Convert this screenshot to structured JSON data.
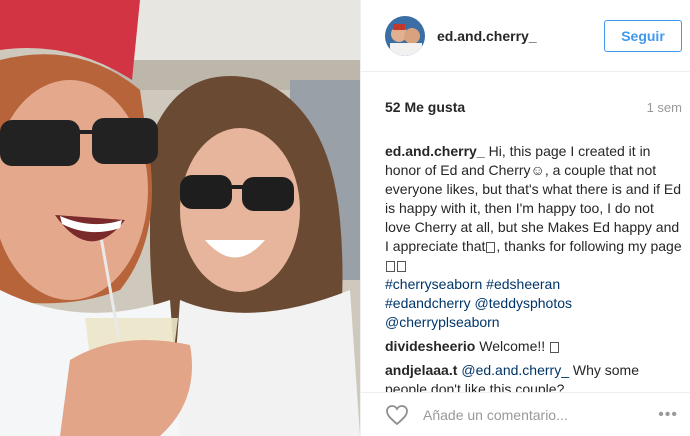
{
  "post": {
    "username": "ed.and.cherry_",
    "follow_label": "Seguir",
    "likes": "52 Me gusta",
    "age": "1 sem"
  },
  "comments": [
    {
      "user": "ed.and.cherry_",
      "text": "Hi, this page I created it in honor of Ed and Cherry☺, a couple that not everyone likes, but that's what there is and if Ed is happy with it, then I'm happy too, I do not love Cherry at all, but she Makes Ed happy and I appreciate that",
      "text2": ", thanks for following my page",
      "tags": [
        "#cherryseaborn",
        "#edsheeran",
        "#edandcherry",
        "@teddysphotos",
        "@cherryplseaborn"
      ]
    },
    {
      "user": "dividesheerio",
      "text": "Welcome!!"
    },
    {
      "user": "andjelaaa.t",
      "mention": "@ed.and.cherry_",
      "text": "Why some people don't like this couple?"
    }
  ],
  "footer": {
    "comment_placeholder": "Añade un comentario...",
    "more_label": "•••"
  },
  "icons": {
    "like": "heart-outline-icon",
    "more": "more-options-icon"
  },
  "colors": {
    "follow": "#3f99ed",
    "hashtag": "#003569",
    "muted": "#999999"
  }
}
